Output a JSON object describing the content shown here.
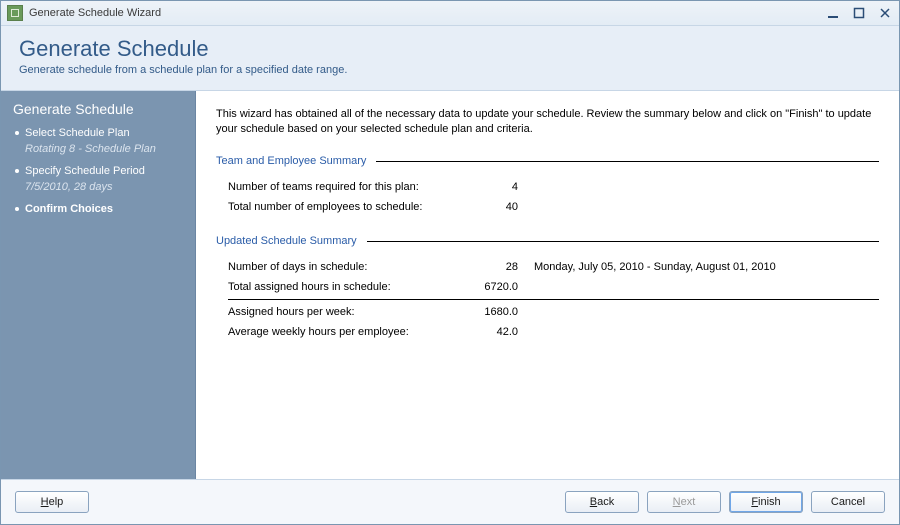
{
  "window": {
    "title": "Generate Schedule Wizard"
  },
  "header": {
    "title": "Generate Schedule",
    "subtitle": "Generate schedule from a schedule plan for a specified date range."
  },
  "sidebar": {
    "title": "Generate Schedule",
    "steps": [
      {
        "title": "Select Schedule Plan",
        "sub": "Rotating 8 - Schedule Plan",
        "current": false
      },
      {
        "title": "Specify Schedule Period",
        "sub": "7/5/2010, 28 days",
        "current": false
      },
      {
        "title": "Confirm Choices",
        "sub": "",
        "current": true
      }
    ]
  },
  "content": {
    "intro": "This wizard has obtained all of the necessary data to update your schedule.  Review the summary below and click on \"Finish\" to update your schedule based on your selected schedule plan and criteria.",
    "section1": {
      "title": "Team and Employee Summary",
      "rows": [
        {
          "label": "Number of teams required for this plan:",
          "value": "4"
        },
        {
          "label": "Total number of employees to schedule:",
          "value": "40"
        }
      ]
    },
    "section2": {
      "title": "Updated Schedule Summary",
      "rows": [
        {
          "label": "Number of days in schedule:",
          "value": "28",
          "extra": "Monday, July 05, 2010 - Sunday, August 01, 2010"
        },
        {
          "label": "Total assigned hours in schedule:",
          "value": "6720.0"
        },
        {
          "label": "Assigned hours per week:",
          "value": "1680.0",
          "divider": true
        },
        {
          "label": "Average weekly hours per employee:",
          "value": "42.0"
        }
      ]
    }
  },
  "footer": {
    "help_pre": "",
    "help_accel": "H",
    "help_post": "elp",
    "back_pre": "",
    "back_accel": "B",
    "back_post": "ack",
    "next_pre": "",
    "next_accel": "N",
    "next_post": "ext",
    "finish_pre": "",
    "finish_accel": "F",
    "finish_post": "inish",
    "cancel": "Cancel"
  }
}
